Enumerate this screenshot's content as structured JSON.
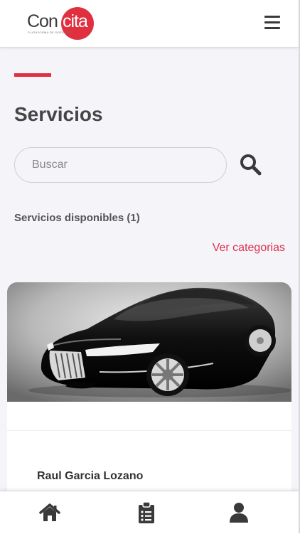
{
  "app": {
    "logo": {
      "left": "Con",
      "right": "cita",
      "tagline": "PLATAFORMA DE SERVICIOS"
    },
    "menu_icon": "hamburger-menu-icon"
  },
  "main": {
    "title": "Servicios",
    "search": {
      "placeholder": "Buscar",
      "value": "",
      "icon": "search-icon"
    },
    "services_count_label": "Servicios disponibles (1)",
    "categories_link": "Ver categorias"
  },
  "services": [
    {
      "image": "black-sports-car-photo",
      "provider_name": "Raul Garcia Lozano"
    }
  ],
  "bottom_nav": [
    {
      "icon": "home-icon"
    },
    {
      "icon": "clipboard-list-icon"
    },
    {
      "icon": "user-icon"
    }
  ],
  "colors": {
    "accent": "#e0303f",
    "link": "#e0304f",
    "background": "#f4f4f9",
    "text": "#454545"
  }
}
